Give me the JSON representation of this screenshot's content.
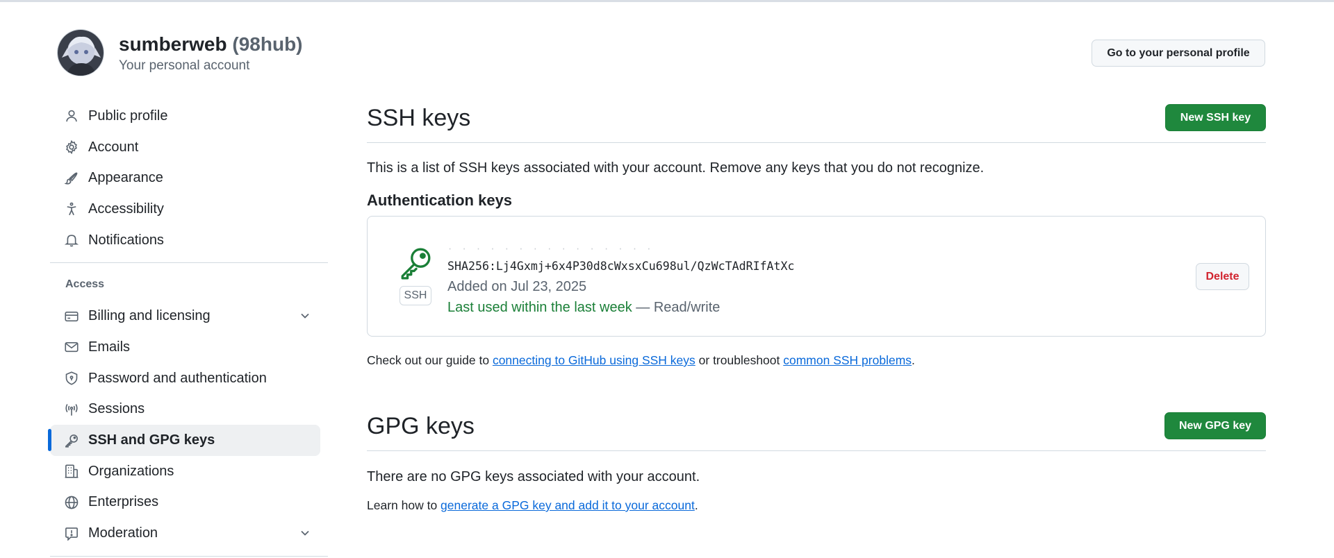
{
  "account": {
    "username": "sumberweb",
    "handle": "(98hub)",
    "subtitle": "Your personal account",
    "profile_button": "Go to your personal profile"
  },
  "sidebar": {
    "items": [
      {
        "label": "Public profile",
        "icon": "person-icon"
      },
      {
        "label": "Account",
        "icon": "gear-icon"
      },
      {
        "label": "Appearance",
        "icon": "paintbrush-icon"
      },
      {
        "label": "Accessibility",
        "icon": "accessibility-icon"
      },
      {
        "label": "Notifications",
        "icon": "bell-icon"
      }
    ],
    "section_label": "Access",
    "access_items": [
      {
        "label": "Billing and licensing",
        "icon": "credit-card-icon",
        "expandable": true
      },
      {
        "label": "Emails",
        "icon": "mail-icon"
      },
      {
        "label": "Password and authentication",
        "icon": "shield-lock-icon"
      },
      {
        "label": "Sessions",
        "icon": "broadcast-icon"
      },
      {
        "label": "SSH and GPG keys",
        "icon": "key-icon",
        "active": true
      },
      {
        "label": "Organizations",
        "icon": "organization-icon"
      },
      {
        "label": "Enterprises",
        "icon": "globe-icon"
      },
      {
        "label": "Moderation",
        "icon": "report-icon",
        "expandable": true
      }
    ]
  },
  "ssh": {
    "title": "SSH keys",
    "new_button": "New SSH key",
    "description": "This is a list of SSH keys associated with your account. Remove any keys that you do not recognize.",
    "auth_heading": "Authentication keys",
    "key": {
      "badge": "SSH",
      "fingerprint": "SHA256:Lj4Gxmj+6x4P30d8cWxsxCu698ul/QzWcTAdRIfAtXc",
      "added": "Added on Jul 23, 2025",
      "last_used": "Last used within the last week",
      "access": "— Read/write",
      "delete_button": "Delete"
    },
    "help": {
      "prefix": "Check out our guide to ",
      "link1": "connecting to GitHub using SSH keys",
      "middle": " or troubleshoot ",
      "link2": "common SSH problems",
      "suffix": "."
    }
  },
  "gpg": {
    "title": "GPG keys",
    "new_button": "New GPG key",
    "empty_text": "There are no GPG keys associated with your account.",
    "help": {
      "prefix": "Learn how to ",
      "link": "generate a GPG key and add it to your account",
      "suffix": "."
    }
  },
  "colors": {
    "primary_green": "#1f883d",
    "link_blue": "#0969da",
    "danger_red": "#d1242f",
    "active_indicator": "#0969da"
  }
}
